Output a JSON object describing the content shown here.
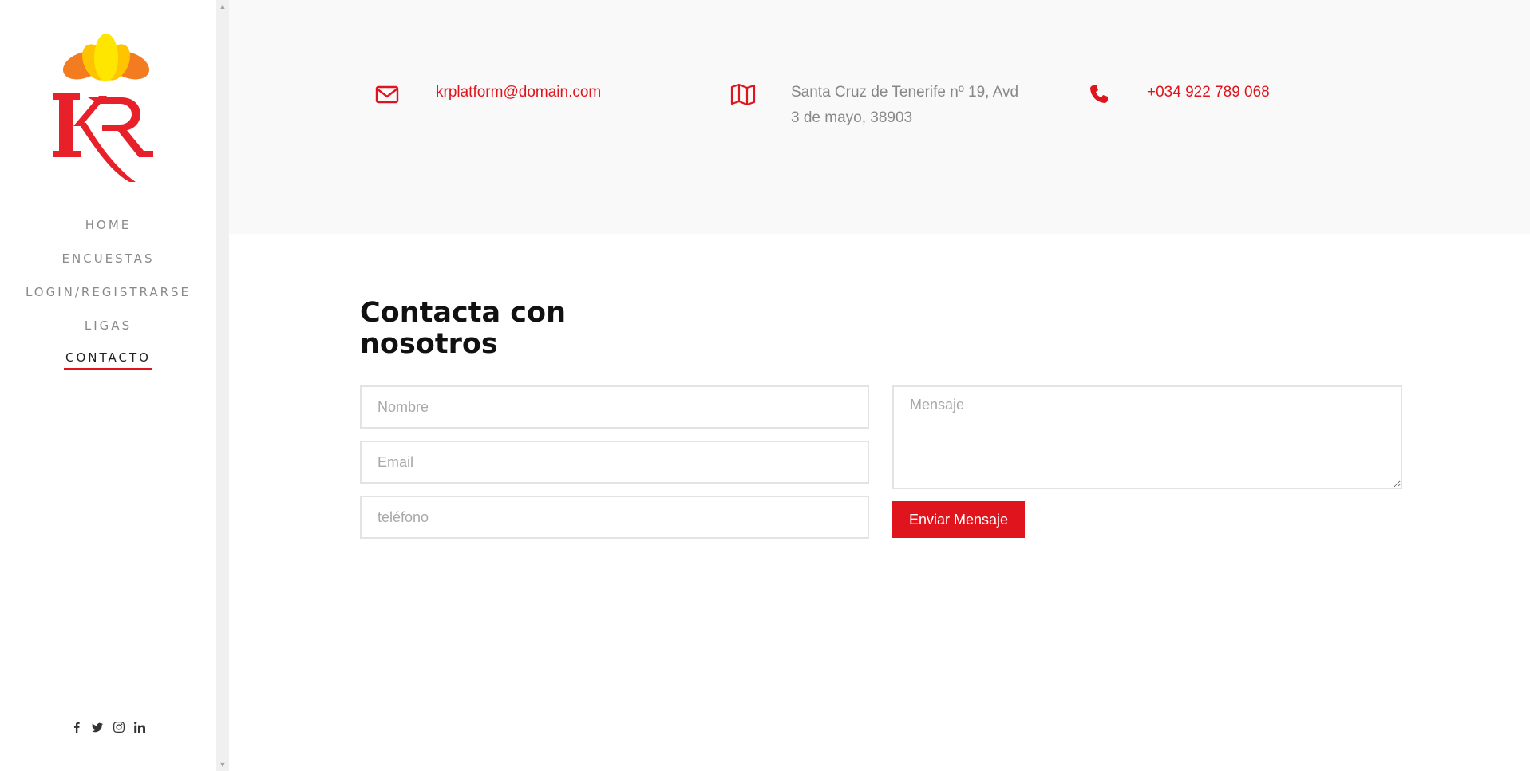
{
  "brand": {
    "logo_letters": "KR",
    "colors": {
      "accent": "#e0141c",
      "petal_outer": "#f47c20",
      "petal_inner": "#ffd400"
    }
  },
  "nav": [
    {
      "label": "HOME",
      "active": false
    },
    {
      "label": "ENCUESTAS",
      "active": false
    },
    {
      "label": "LOGIN/REGISTRARSE",
      "active": false
    },
    {
      "label": "LIGAS",
      "active": false
    },
    {
      "label": "CONTACTO",
      "active": true
    }
  ],
  "social": [
    "facebook-icon",
    "twitter-icon",
    "instagram-icon",
    "linkedin-icon"
  ],
  "info": {
    "email": {
      "icon": "envelope-icon",
      "text": "krplatform@domain.com"
    },
    "address": {
      "icon": "map-icon",
      "line1": "Santa Cruz de Tenerife nº 19, Avd",
      "line2": "3 de mayo, 38903"
    },
    "phone": {
      "icon": "phone-icon",
      "text": "+034 922 789 068"
    }
  },
  "contact": {
    "title_line1": "Contacta con",
    "title_line2": "nosotros",
    "name_placeholder": "Nombre",
    "email_placeholder": "Email",
    "phone_placeholder": "teléfono",
    "message_placeholder": "Mensaje",
    "submit_label": "Enviar Mensaje"
  }
}
